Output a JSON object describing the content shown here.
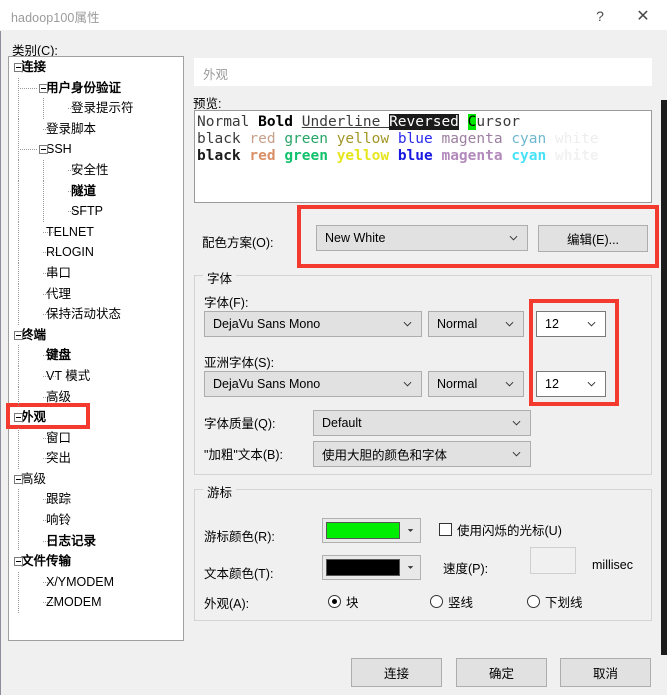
{
  "window": {
    "title": "hadoop100属性",
    "help_label": "?",
    "close_label": "✕"
  },
  "category": {
    "label": "类别(C):",
    "items": [
      {
        "label": "连接",
        "depth": 0,
        "bold": true,
        "expander": true
      },
      {
        "label": "用户身份验证",
        "depth": 1,
        "bold": true,
        "expander": true
      },
      {
        "label": "登录提示符",
        "depth": 2,
        "bold": false,
        "expander": false
      },
      {
        "label": "登录脚本",
        "depth": 1,
        "bold": false,
        "expander": false
      },
      {
        "label": "SSH",
        "depth": 1,
        "bold": false,
        "expander": true
      },
      {
        "label": "安全性",
        "depth": 2,
        "bold": false,
        "expander": false
      },
      {
        "label": "隧道",
        "depth": 2,
        "bold": true,
        "expander": false
      },
      {
        "label": "SFTP",
        "depth": 2,
        "bold": false,
        "expander": false
      },
      {
        "label": "TELNET",
        "depth": 1,
        "bold": false,
        "expander": false
      },
      {
        "label": "RLOGIN",
        "depth": 1,
        "bold": false,
        "expander": false
      },
      {
        "label": "串口",
        "depth": 1,
        "bold": false,
        "expander": false
      },
      {
        "label": "代理",
        "depth": 1,
        "bold": false,
        "expander": false
      },
      {
        "label": "保持活动状态",
        "depth": 1,
        "bold": false,
        "expander": false
      },
      {
        "label": "终端",
        "depth": 0,
        "bold": true,
        "expander": true
      },
      {
        "label": "键盘",
        "depth": 1,
        "bold": true,
        "expander": false
      },
      {
        "label": "VT 模式",
        "depth": 1,
        "bold": false,
        "expander": false
      },
      {
        "label": "高级",
        "depth": 1,
        "bold": false,
        "expander": false
      },
      {
        "label": "外观",
        "depth": 0,
        "bold": true,
        "expander": true
      },
      {
        "label": "窗口",
        "depth": 1,
        "bold": false,
        "expander": false
      },
      {
        "label": "突出",
        "depth": 1,
        "bold": false,
        "expander": false
      },
      {
        "label": "高级",
        "depth": 0,
        "bold": false,
        "expander": true
      },
      {
        "label": "跟踪",
        "depth": 1,
        "bold": false,
        "expander": false
      },
      {
        "label": "响铃",
        "depth": 1,
        "bold": false,
        "expander": false
      },
      {
        "label": "日志记录",
        "depth": 1,
        "bold": true,
        "expander": false
      },
      {
        "label": "文件传输",
        "depth": 0,
        "bold": true,
        "expander": true
      },
      {
        "label": "X/YMODEM",
        "depth": 1,
        "bold": false,
        "expander": false
      },
      {
        "label": "ZMODEM",
        "depth": 1,
        "bold": false,
        "expander": false
      }
    ],
    "selected": "外观"
  },
  "panel": {
    "header_value": "外观",
    "preview_label": "预览:",
    "preview": {
      "line1": [
        {
          "text": "Normal ",
          "color": "#3b3b3b",
          "bold": false
        },
        {
          "text": "Bold ",
          "color": "#000000",
          "bold": true
        },
        {
          "text": "Underline ",
          "color": "#3b3b3b",
          "bold": false,
          "underline": true
        },
        {
          "text": "Reversed",
          "color": "#ffffff",
          "bg": "#1a1a1a",
          "bold": false
        },
        {
          "text": " ",
          "color": "#3b3b3b"
        },
        {
          "text": "C",
          "color": "#000000",
          "bg": "#00e800"
        },
        {
          "text": "ursor",
          "color": "#3b3b3b"
        }
      ],
      "line2": [
        {
          "text": "black",
          "color": "#3b3b3b"
        },
        {
          "text": "red",
          "color": "#c8a08a"
        },
        {
          "text": "green",
          "color": "#27a567"
        },
        {
          "text": "yellow",
          "color": "#a39626"
        },
        {
          "text": "blue",
          "color": "#2a2aee"
        },
        {
          "text": "magenta",
          "color": "#9c7fa0"
        },
        {
          "text": "cyan",
          "color": "#6fb7cf"
        },
        {
          "text": "white",
          "color": "#ededed"
        }
      ],
      "line3": [
        {
          "text": "black",
          "color": "#1a1a1a"
        },
        {
          "text": "red",
          "color": "#d98f67"
        },
        {
          "text": "green",
          "color": "#11c16b"
        },
        {
          "text": "yellow",
          "color": "#e6e61e"
        },
        {
          "text": "blue",
          "color": "#1818e0"
        },
        {
          "text": "magenta",
          "color": "#b289bb"
        },
        {
          "text": "cyan",
          "color": "#46e2f7"
        },
        {
          "text": "white",
          "color": "#f2f2f2"
        }
      ]
    },
    "color_scheme": {
      "label": "配色方案(O):",
      "value": "New White",
      "edit_label": "编辑(E)..."
    },
    "font_group": {
      "title": "字体",
      "font_label": "字体(F):",
      "font_value": "DejaVu Sans Mono",
      "font_style": "Normal",
      "font_size": "12",
      "asian_label": "亚洲字体(S):",
      "asian_value": "DejaVu Sans Mono",
      "asian_style": "Normal",
      "asian_size": "12",
      "quality_label": "字体质量(Q):",
      "quality_value": "Default",
      "bold_label": "\"加粗\"文本(B):",
      "bold_value": "使用大胆的颜色和字体"
    },
    "cursor_group": {
      "title": "游标",
      "cursor_color_label": "游标颜色(R):",
      "cursor_color": "#00ef00",
      "text_color_label": "文本颜色(T):",
      "text_color": "#000000",
      "blink_label": "使用闪烁的光标(U)",
      "blink_checked": false,
      "speed_label": "速度(P):",
      "speed_value": "",
      "speed_unit": "millisec",
      "appearance_label": "外观(A):",
      "options": [
        {
          "label": "块",
          "selected": true
        },
        {
          "label": "竖线",
          "selected": false
        },
        {
          "label": "下划线",
          "selected": false
        }
      ]
    }
  },
  "footer": {
    "connect": "连接",
    "ok": "确定",
    "cancel": "取消"
  },
  "annotations": {
    "accent": "#f4392e",
    "boxes": [
      "tree-appearance",
      "color-scheme-row",
      "font-size-dropdowns"
    ]
  }
}
